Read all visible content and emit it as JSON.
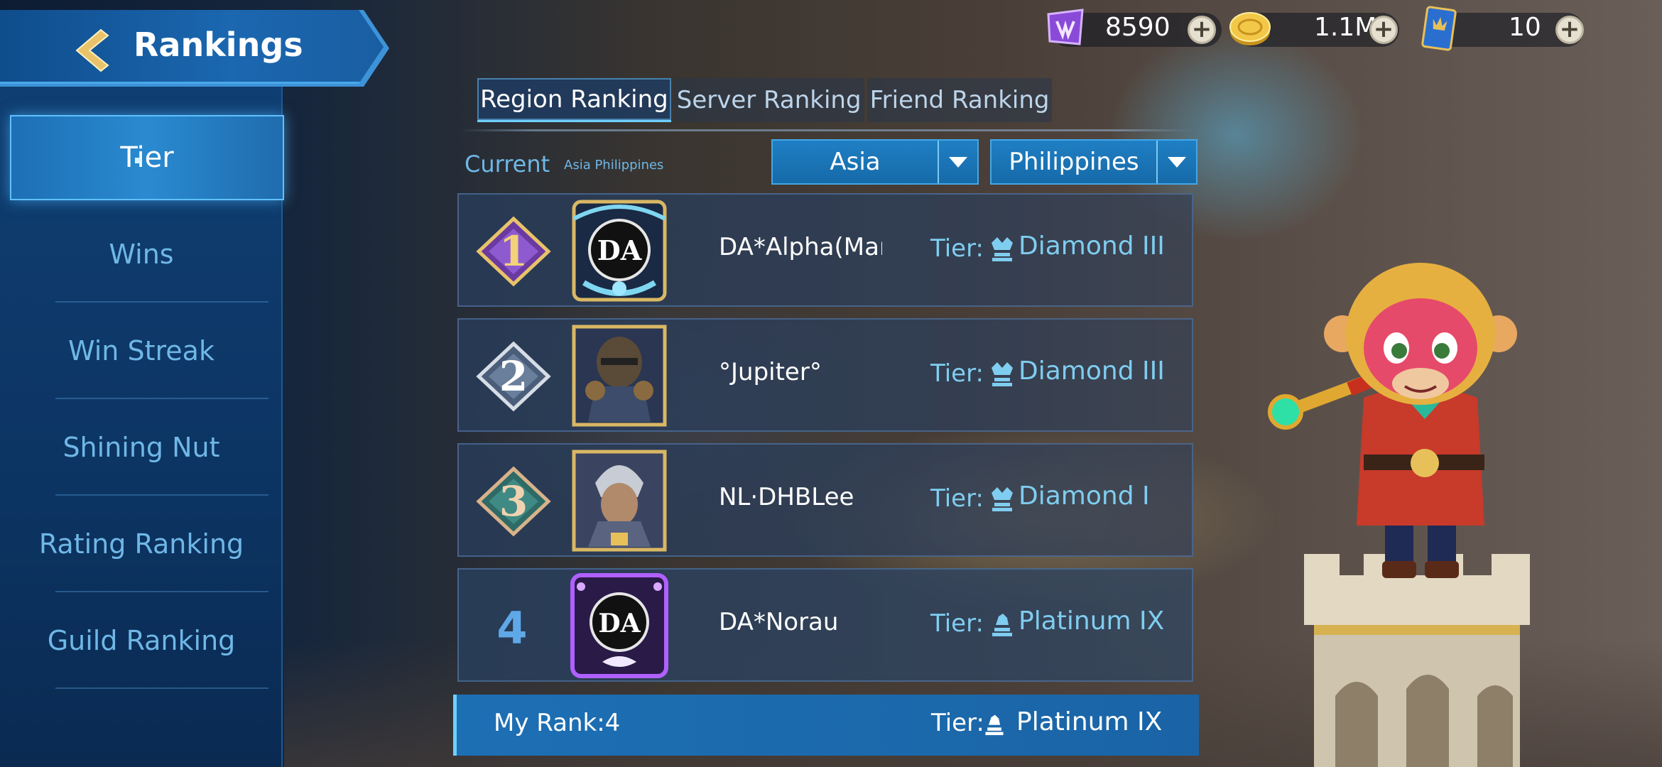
{
  "header": {
    "title": "Rankings",
    "back_icon": "back-arrow-icon"
  },
  "currencies": [
    {
      "icon": "purple-gem-icon",
      "value": "8590"
    },
    {
      "icon": "gold-coin-icon",
      "value": "1.1M"
    },
    {
      "icon": "blue-ticket-icon",
      "value": "10"
    }
  ],
  "sidebar": {
    "items": [
      {
        "label": "Tier",
        "active": true
      },
      {
        "label": "Wins"
      },
      {
        "label": "Win Streak"
      },
      {
        "label": "Shining Nut"
      },
      {
        "label": "Rating Ranking"
      },
      {
        "label": "Guild Ranking"
      }
    ]
  },
  "tabs": [
    {
      "label": "Region Ranking",
      "active": true
    },
    {
      "label": "Server Ranking"
    },
    {
      "label": "Friend Ranking"
    }
  ],
  "region": {
    "current_label": "Current",
    "current_value": "Asia Philippines",
    "continent": "Asia",
    "country": "Philippines"
  },
  "rankings": [
    {
      "rank": "1",
      "name": "DA*Alpha(Mark...",
      "tier_label": "Tier:",
      "tier": "Diamond III"
    },
    {
      "rank": "2",
      "name": "°Jupiter°",
      "tier_label": "Tier:",
      "tier": "Diamond III"
    },
    {
      "rank": "3",
      "name": "NL·DHBLee",
      "tier_label": "Tier:",
      "tier": "Diamond I"
    },
    {
      "rank": "4",
      "name": "DA*Norau",
      "tier_label": "Tier:",
      "tier": "Platinum IX"
    }
  ],
  "my_rank": {
    "label": "My Rank:4",
    "tier_label": "Tier:",
    "tier": "Platinum IX"
  },
  "colors": {
    "accent": "#6fd0ff",
    "sidebar": "#0f3e72",
    "tier_text": "#7fcdf0"
  }
}
